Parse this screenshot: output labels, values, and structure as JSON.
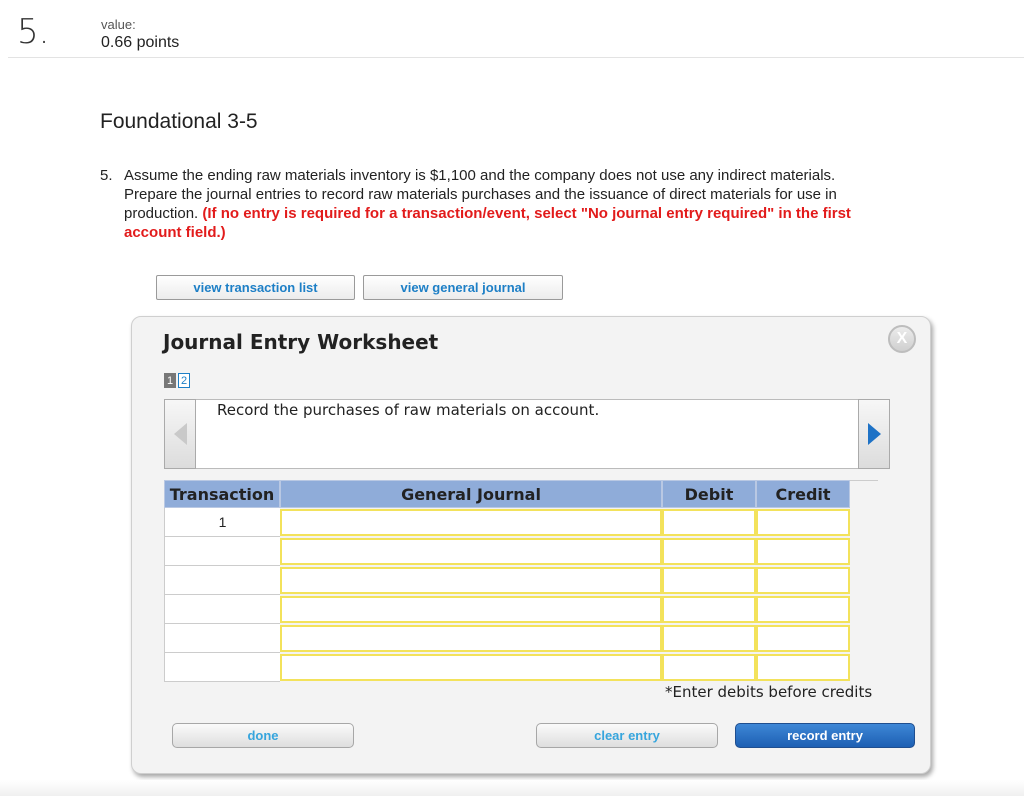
{
  "question": {
    "number": "5.",
    "value_label": "value:",
    "value_points": "0.66 points",
    "title": "Foundational 3-5",
    "item_number": "5.",
    "text": "Assume the ending raw materials inventory is $1,100 and the company does not use any indirect materials. Prepare the journal entries to record raw materials purchases and the issuance of direct materials for use in production.",
    "instruction": "(If no entry is required for a transaction/event, select \"No journal entry required\" in the first account field.)"
  },
  "buttons": {
    "view_transaction_list": "view transaction list",
    "view_general_journal": "view general journal"
  },
  "worksheet": {
    "title": "Journal Entry Worksheet",
    "close_label": "X",
    "pages": [
      "1",
      "2"
    ],
    "instruction": "Record the purchases of raw materials on account.",
    "columns": [
      "Transaction",
      "General Journal",
      "Debit",
      "Credit"
    ],
    "rows": [
      {
        "transaction": "1",
        "account": "",
        "debit": "",
        "credit": ""
      },
      {
        "transaction": "",
        "account": "",
        "debit": "",
        "credit": ""
      },
      {
        "transaction": "",
        "account": "",
        "debit": "",
        "credit": ""
      },
      {
        "transaction": "",
        "account": "",
        "debit": "",
        "credit": ""
      },
      {
        "transaction": "",
        "account": "",
        "debit": "",
        "credit": ""
      },
      {
        "transaction": "",
        "account": "",
        "debit": "",
        "credit": ""
      }
    ],
    "hint": "*Enter debits before credits",
    "done_label": "done",
    "clear_label": "clear entry",
    "record_label": "record entry"
  },
  "colors": {
    "accent_red": "#e21b1b",
    "link_blue": "#1d7fc6",
    "header_blue": "#8facd9",
    "input_border_yellow": "#f3e25b",
    "record_button_blue": "#2a6fc4"
  },
  "icons": [
    "close-icon",
    "arrow-left-icon",
    "arrow-right-icon"
  ]
}
